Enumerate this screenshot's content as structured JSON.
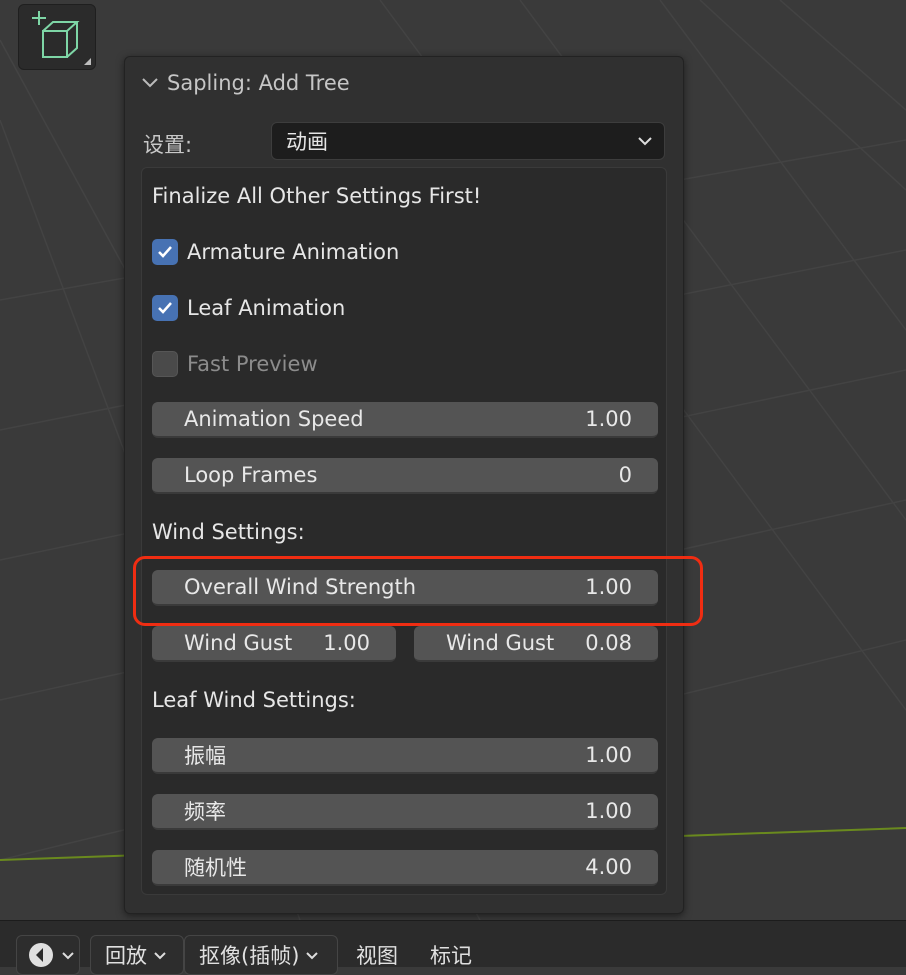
{
  "panel": {
    "title": "Sapling: Add Tree",
    "settings_label": "设置:",
    "settings_value": "动画"
  },
  "animation": {
    "heading": "Finalize All Other Settings First!",
    "armature_animation": {
      "label": "Armature Animation",
      "checked": true
    },
    "leaf_animation": {
      "label": "Leaf Animation",
      "checked": true
    },
    "fast_preview": {
      "label": "Fast Preview",
      "checked": false
    },
    "animation_speed": {
      "label": "Animation Speed",
      "value": "1.00"
    },
    "loop_frames": {
      "label": "Loop Frames",
      "value": "0"
    }
  },
  "wind": {
    "heading": "Wind Settings:",
    "overall_strength": {
      "label": "Overall Wind Strength",
      "value": "1.00"
    },
    "gust_left": {
      "label": "Wind Gust",
      "value": "1.00"
    },
    "gust_right": {
      "label": "Wind Gust",
      "value": "0.08"
    }
  },
  "leaf_wind": {
    "heading": "Leaf Wind Settings:",
    "amplitude": {
      "label": "振幅",
      "value": "1.00"
    },
    "frequency": {
      "label": "频率",
      "value": "1.00"
    },
    "randomness": {
      "label": "随机性",
      "value": "4.00"
    }
  },
  "bottom_bar": {
    "playback": "回放",
    "keying": "抠像(插帧)",
    "view": "视图",
    "marker": "标记"
  },
  "colors": {
    "accent_checkbox": "#4772b3",
    "highlight": "#f02d12",
    "gizmo_green": "#7ed6a6",
    "ground_line": "#6a8a1e"
  }
}
